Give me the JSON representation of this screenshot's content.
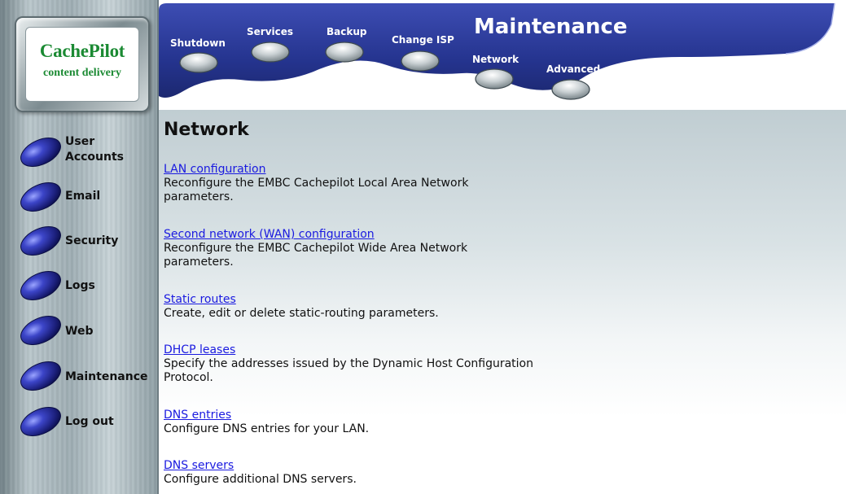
{
  "logo": {
    "title": "CachePilot",
    "subtitle": "content delivery"
  },
  "sidebar": {
    "items": [
      {
        "label": "User Accounts",
        "line1": "User",
        "line2": "Accounts"
      },
      {
        "label": "Email"
      },
      {
        "label": "Security"
      },
      {
        "label": "Logs"
      },
      {
        "label": "Web"
      },
      {
        "label": "Maintenance"
      },
      {
        "label": "Log out"
      }
    ]
  },
  "header": {
    "title": "Maintenance",
    "tabs": [
      {
        "label": "Shutdown"
      },
      {
        "label": "Services"
      },
      {
        "label": "Backup"
      },
      {
        "label": "Change ISP"
      },
      {
        "label": "Network"
      },
      {
        "label": "Advanced"
      }
    ]
  },
  "main": {
    "title": "Network",
    "entries": [
      {
        "link": "LAN configuration",
        "desc_line1": "Reconfigure the EMBC Cachepilot Local Area Network",
        "desc_line2": "parameters."
      },
      {
        "link": "Second network (WAN) configuration",
        "desc_line1": "Reconfigure the EMBC Cachepilot Wide Area Network",
        "desc_line2": "parameters."
      },
      {
        "link": "Static routes",
        "desc_line1": "Create, edit or delete static-routing parameters."
      },
      {
        "link": "DHCP leases",
        "desc_line1": "Specify the addresses issued by the Dynamic Host Configuration",
        "desc_line2": "Protocol."
      },
      {
        "link": "DNS entries",
        "desc_line1": "Configure DNS entries for your LAN."
      },
      {
        "link": "DNS servers",
        "desc_line1": "Configure additional DNS servers."
      }
    ]
  },
  "colors": {
    "header_blue": "#25348f",
    "link_blue": "#1a1ae0",
    "logo_green": "#1b8a33"
  }
}
